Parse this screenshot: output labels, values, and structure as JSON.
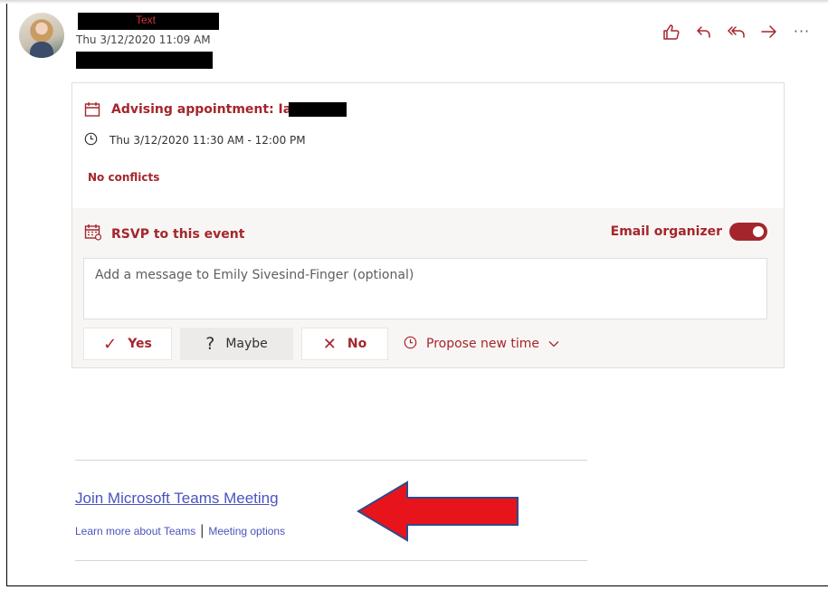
{
  "header": {
    "sender_name": "Text",
    "date": "Thu 3/12/2020 11:09 AM"
  },
  "toolbar": {
    "icons": [
      "like-icon",
      "reply-icon",
      "reply-all-icon",
      "forward-icon",
      "more-icon"
    ],
    "like_glyph": "👍",
    "reply_glyph": "↶",
    "reply_all_glyph": "⇇",
    "forward_glyph": "→",
    "more_glyph": "···"
  },
  "event": {
    "title": "Advising appointment: Ian",
    "time": "Thu 3/12/2020 11:30 AM - 12:00 PM",
    "conflicts": "No conflicts"
  },
  "rsvp": {
    "title": "RSVP to this event",
    "email_organizer_label": "Email organizer",
    "email_organizer_on": true,
    "message_placeholder": "Add a message to Emily Sivesind-Finger (optional)",
    "yes_label": "Yes",
    "maybe_label": "Maybe",
    "no_label": "No",
    "propose_label": "Propose new time",
    "yes_glyph": "✓",
    "maybe_glyph": "?",
    "no_glyph": "✕",
    "chevron_glyph": "⌄"
  },
  "teams": {
    "join_label": "Join Microsoft Teams Meeting",
    "learn_more_label": "Learn more about Teams",
    "separator": "|",
    "meeting_options_label": "Meeting options"
  },
  "colors": {
    "accent": "#a4262c",
    "link": "#4b53bc",
    "arrow_fill": "#e8141b",
    "arrow_stroke": "#2f4a8a"
  }
}
